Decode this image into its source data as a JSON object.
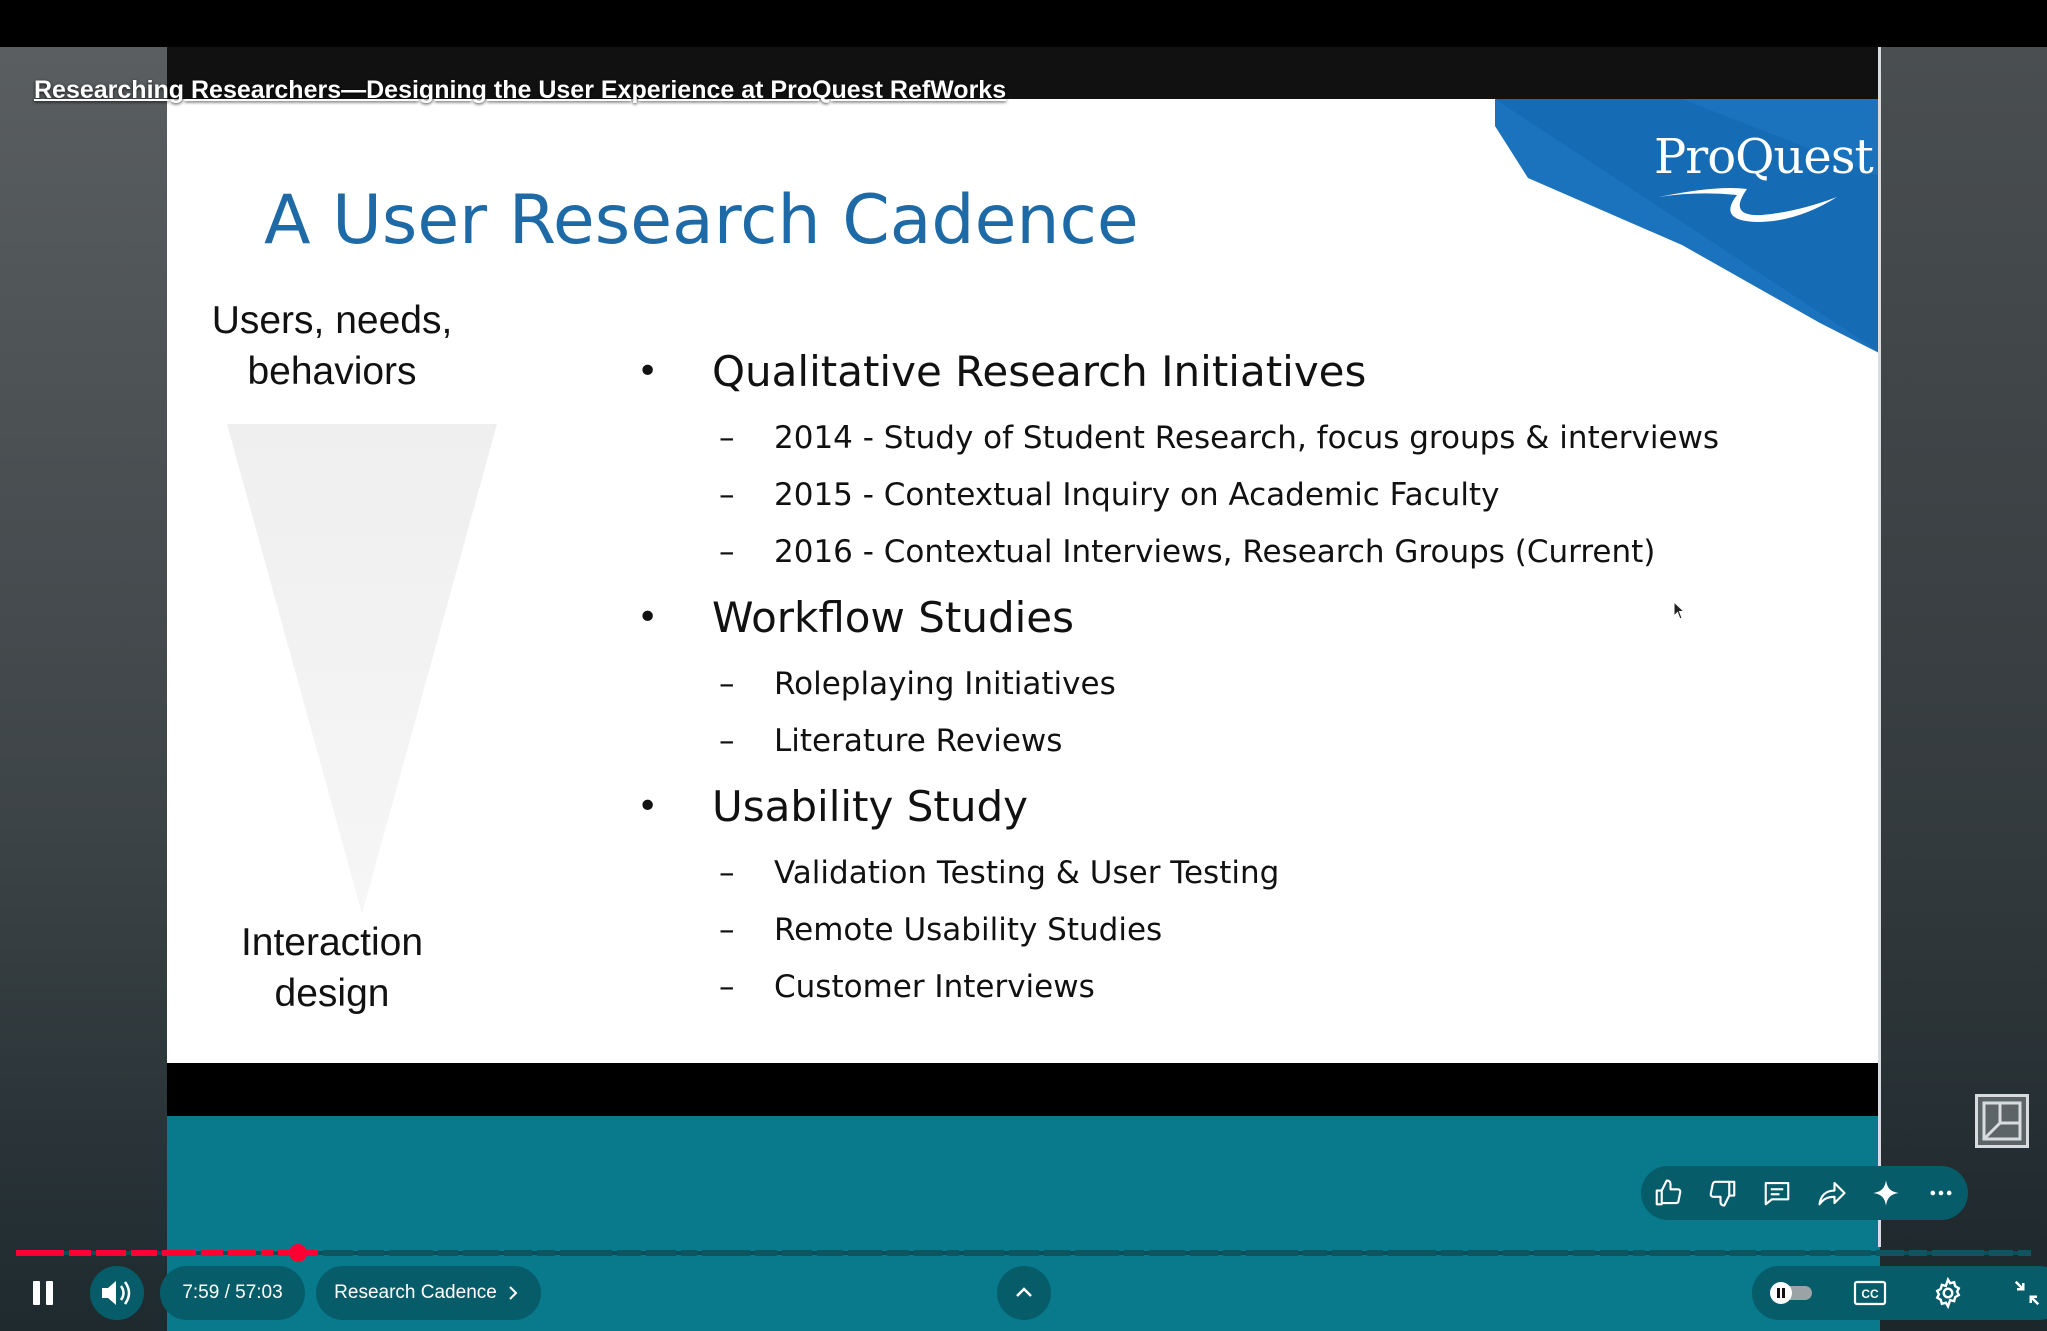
{
  "video": {
    "title": "Researching Researchers—Designing the User Experience at ProQuest RefWorks"
  },
  "slide": {
    "title": "A User Research Cadence",
    "logo": "ProQuest",
    "funnel_top": [
      "Users, needs,",
      "behaviors"
    ],
    "funnel_bottom": [
      "Interaction",
      "design"
    ],
    "sections": [
      {
        "heading": "Qualitative Research Initiatives",
        "items": [
          "2014 - Study of Student Research, focus groups & interviews",
          "2015 - Contextual Inquiry on Academic Faculty",
          "2016 - Contextual Interviews, Research Groups (Current)"
        ]
      },
      {
        "heading": "Workflow Studies",
        "items": [
          "Roleplaying Initiatives",
          "Literature Reviews"
        ]
      },
      {
        "heading": "Usability Study",
        "items": [
          "Validation Testing & User Testing",
          "Remote Usability Studies",
          "Customer Interviews"
        ]
      }
    ],
    "colors": {
      "title": "#1e6aa7",
      "wedge": "#1a73bc"
    }
  },
  "player": {
    "current_time": "7:59",
    "total_time": "57:03",
    "time_display": "7:59 / 57:03",
    "progress_fraction": 0.1399,
    "chapter_label": "Research Cadence",
    "accent": "#ff0033",
    "icons": {
      "pause": "pause-icon",
      "volume": "volume-icon",
      "like": "thumbs-up-icon",
      "dislike": "thumbs-down-icon",
      "comment": "comment-icon",
      "share": "share-icon",
      "ask": "sparkle-icon",
      "more": "more-icon",
      "autoplay": "autoplay-toggle-icon",
      "captions": "cc-icon",
      "settings": "gear-icon",
      "exit_fullscreen": "exit-fullscreen-icon",
      "expand": "chevron-up-icon",
      "miniplayer": "miniplayer-icon"
    }
  }
}
